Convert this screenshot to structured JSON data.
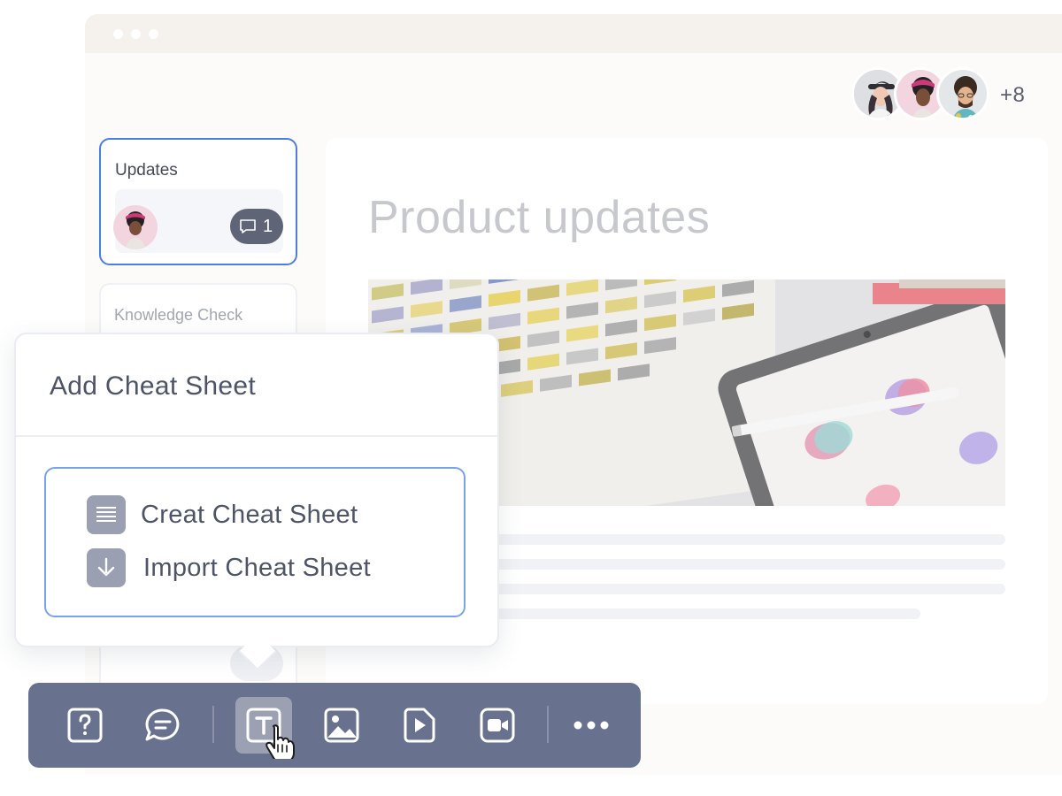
{
  "collaborators": {
    "overflow_count": "+8"
  },
  "sidebar": {
    "cards": [
      {
        "title": "Updates",
        "comment_count": "1"
      },
      {
        "title": "Knowledge Check"
      }
    ]
  },
  "main": {
    "title": "Product updates"
  },
  "popup": {
    "title": "Add Cheat Sheet",
    "options": [
      {
        "label": "Creat Cheat Sheet",
        "icon": "list-icon"
      },
      {
        "label": "Import Cheat Sheet",
        "icon": "download-icon"
      }
    ]
  },
  "toolbar": {
    "buttons": [
      {
        "icon": "question-icon"
      },
      {
        "icon": "comment-icon"
      },
      {
        "icon": "text-icon",
        "active": true
      },
      {
        "icon": "image-icon"
      },
      {
        "icon": "video-icon"
      },
      {
        "icon": "camera-icon"
      },
      {
        "icon": "more-icon"
      }
    ]
  },
  "colors": {
    "accent": "#4a7ee3",
    "toolbar": "#68718e",
    "text": "#4e5468"
  }
}
